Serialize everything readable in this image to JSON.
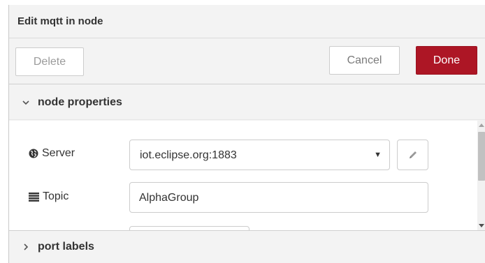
{
  "header": {
    "title": "Edit mqtt in node"
  },
  "toolbar": {
    "delete_label": "Delete",
    "cancel_label": "Cancel",
    "done_label": "Done"
  },
  "sections": {
    "node_properties": {
      "label": "node properties",
      "expanded": true,
      "icon": "chevron-down-icon"
    },
    "port_labels": {
      "label": "port labels",
      "expanded": false,
      "icon": "chevron-right-icon"
    }
  },
  "form": {
    "server": {
      "label": "Server",
      "icon": "globe-icon",
      "value": "iot.eclipse.org:1883",
      "edit_icon": "pencil-icon"
    },
    "topic": {
      "label": "Topic",
      "icon": "list-icon",
      "value": "AlphaGroup"
    }
  },
  "colors": {
    "done_bg": "#ad1625",
    "panel_bg": "#f3f3f3"
  }
}
